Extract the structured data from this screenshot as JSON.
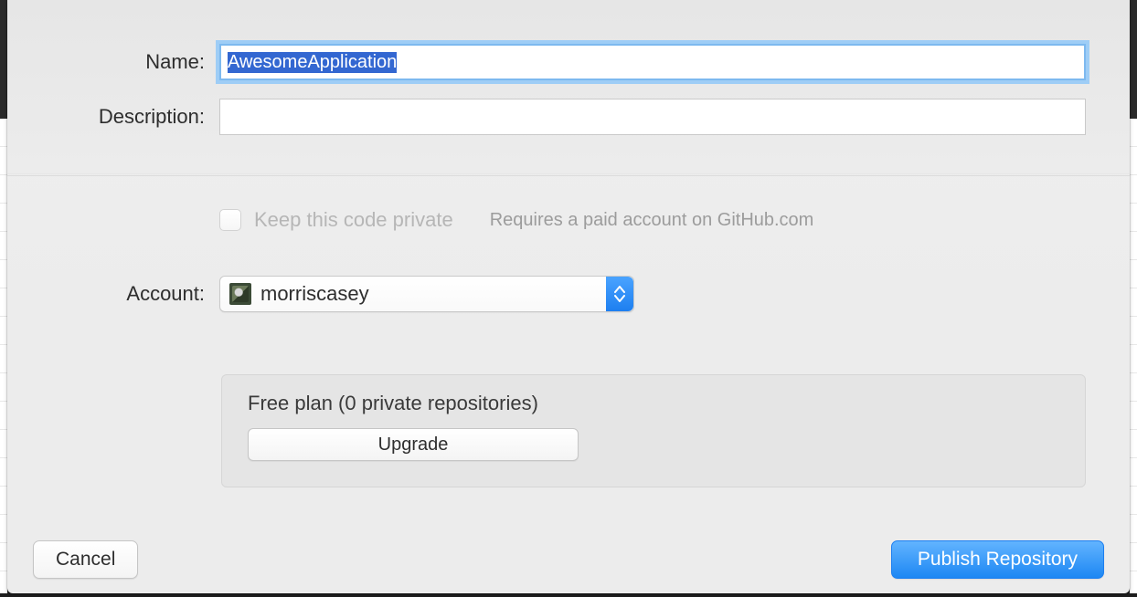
{
  "labels": {
    "name": "Name:",
    "description": "Description:",
    "account": "Account:"
  },
  "fields": {
    "name_value": "AwesomeApplication",
    "description_value": ""
  },
  "private": {
    "checkbox_checked": false,
    "label": "Keep this code private",
    "hint": "Requires a paid account on GitHub.com"
  },
  "account": {
    "selected": "morriscasey"
  },
  "plan": {
    "title": "Free plan (0 private repositories)",
    "upgrade_label": "Upgrade"
  },
  "buttons": {
    "cancel": "Cancel",
    "publish": "Publish Repository"
  }
}
